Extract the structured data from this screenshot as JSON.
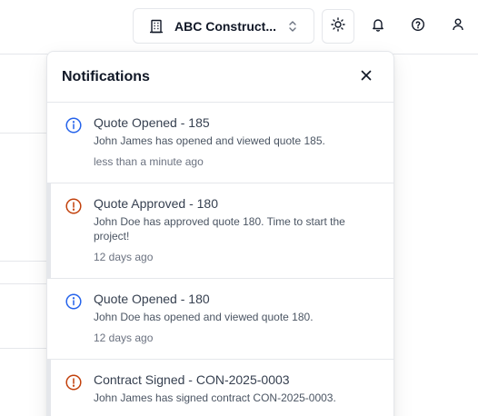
{
  "header": {
    "company_name": "ABC Construct...",
    "icons": {
      "company": "building-icon",
      "switcher": "chevron-up-down-icon",
      "theme": "sun-icon",
      "notifications": "bell-icon",
      "help": "help-circle-icon",
      "account": "user-icon"
    }
  },
  "notifications": {
    "title": "Notifications",
    "close_icon": "close-icon",
    "items": [
      {
        "type": "info",
        "title": "Quote Opened - 185",
        "body": "John James has opened and viewed quote 185.",
        "time": "less than a minute ago"
      },
      {
        "type": "alert",
        "title": "Quote Approved - 180",
        "body": "John Doe has approved quote 180. Time to start the project!",
        "time": "12 days ago"
      },
      {
        "type": "info",
        "title": "Quote Opened - 180",
        "body": "John Doe has opened and viewed quote 180.",
        "time": "12 days ago"
      },
      {
        "type": "alert",
        "title": "Contract Signed - CON-2025-0003",
        "body": "John James has signed contract CON-2025-0003.",
        "time": ""
      }
    ]
  },
  "colors": {
    "info": "#2563eb",
    "alert": "#c2410c",
    "border": "#e5e7eb"
  }
}
